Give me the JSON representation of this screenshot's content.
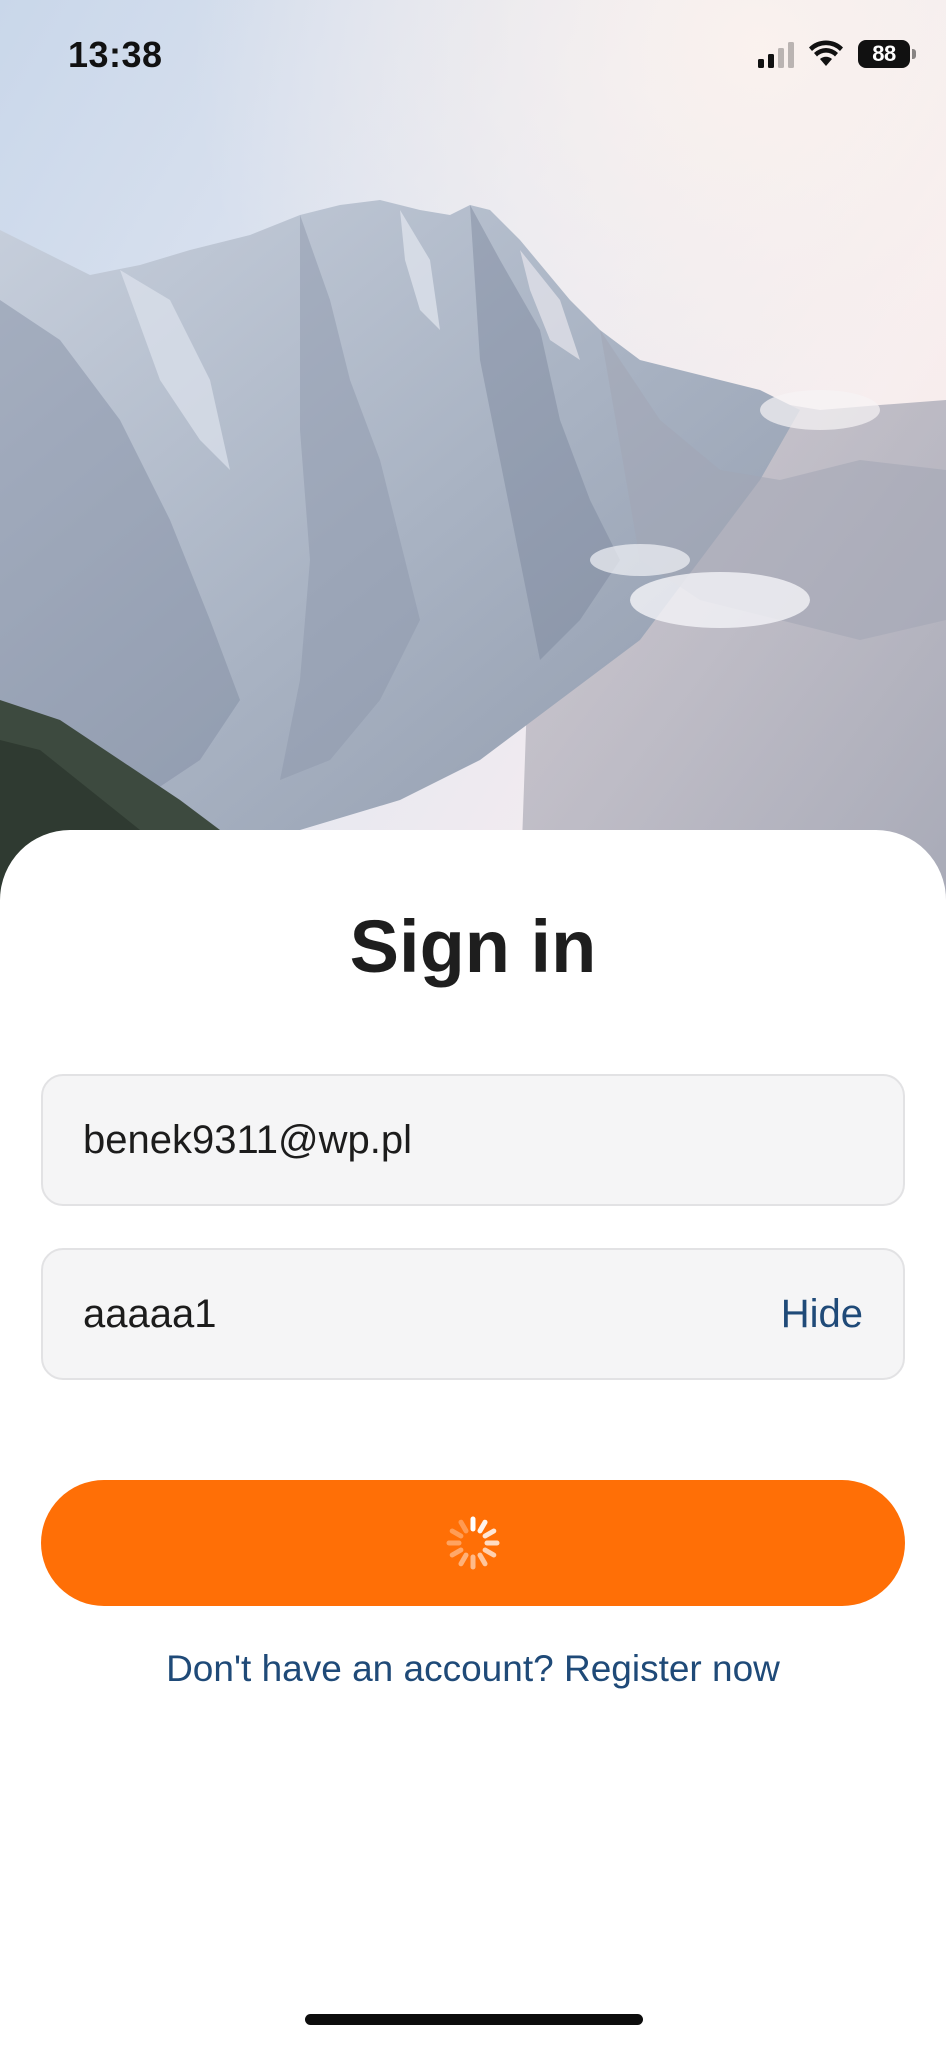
{
  "status_bar": {
    "time": "13:38",
    "battery_level": "88",
    "signal_bars_active": 2,
    "signal_bars_total": 4,
    "icons": [
      "signal-icon",
      "wifi-icon",
      "battery-icon"
    ]
  },
  "background": {
    "icon": "mountain-photo"
  },
  "sign_in": {
    "title": "Sign in",
    "email_value": "benek9311@wp.pl",
    "password_value": "aaaaa1",
    "password_toggle_label": "Hide",
    "submit_state_icon": "loading-spinner-icon",
    "register_link": "Don't have an account? Register now"
  },
  "colors": {
    "accent": "#ff6f06",
    "link": "#1f4a78",
    "field_background": "#f5f5f6",
    "title": "#1e1e1e"
  }
}
